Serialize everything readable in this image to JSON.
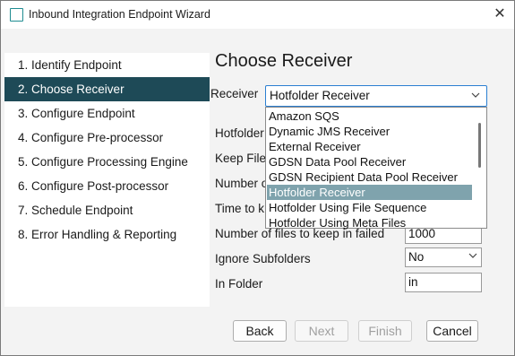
{
  "window": {
    "title": "Inbound Integration Endpoint Wizard",
    "close_glyph": "✕"
  },
  "nav": {
    "items": [
      {
        "label": "1. Identify Endpoint",
        "active": false
      },
      {
        "label": "2. Choose Receiver",
        "active": true
      },
      {
        "label": "3. Configure Endpoint",
        "active": false
      },
      {
        "label": "4. Configure Pre-processor",
        "active": false
      },
      {
        "label": "5. Configure Processing Engine",
        "active": false
      },
      {
        "label": "6. Configure Post-processor",
        "active": false
      },
      {
        "label": "7. Schedule Endpoint",
        "active": false
      },
      {
        "label": "8. Error Handling & Reporting",
        "active": false
      }
    ]
  },
  "page": {
    "title": "Choose Receiver"
  },
  "receiver": {
    "label": "Receiver",
    "selected": "Hotfolder Receiver",
    "options": [
      "Amazon SQS",
      "Dynamic JMS Receiver",
      "External Receiver",
      "GDSN Data Pool Receiver",
      "GDSN Recipient Data Pool Receiver",
      "Hotfolder Receiver",
      "Hotfolder Using File Sequence",
      "Hotfolder Using Meta Files"
    ]
  },
  "fields": {
    "hotfolder_label": "Hotfolder",
    "keep_file_label": "Keep File",
    "number_label": "Number o",
    "time_label": "Time to k",
    "failed_label": "Number of files to keep in failed",
    "failed_value": "1000",
    "ignore_label": "Ignore Subfolders",
    "ignore_value": "No",
    "in_folder_label": "In Folder",
    "in_folder_value": "in"
  },
  "buttons": {
    "back": "Back",
    "next": "Next",
    "finish": "Finish",
    "cancel": "Cancel"
  },
  "colors": {
    "active_nav_bg": "#1e4a57",
    "selected_option_bg": "#7fa3ad",
    "focus_border": "#2b7fd1"
  }
}
